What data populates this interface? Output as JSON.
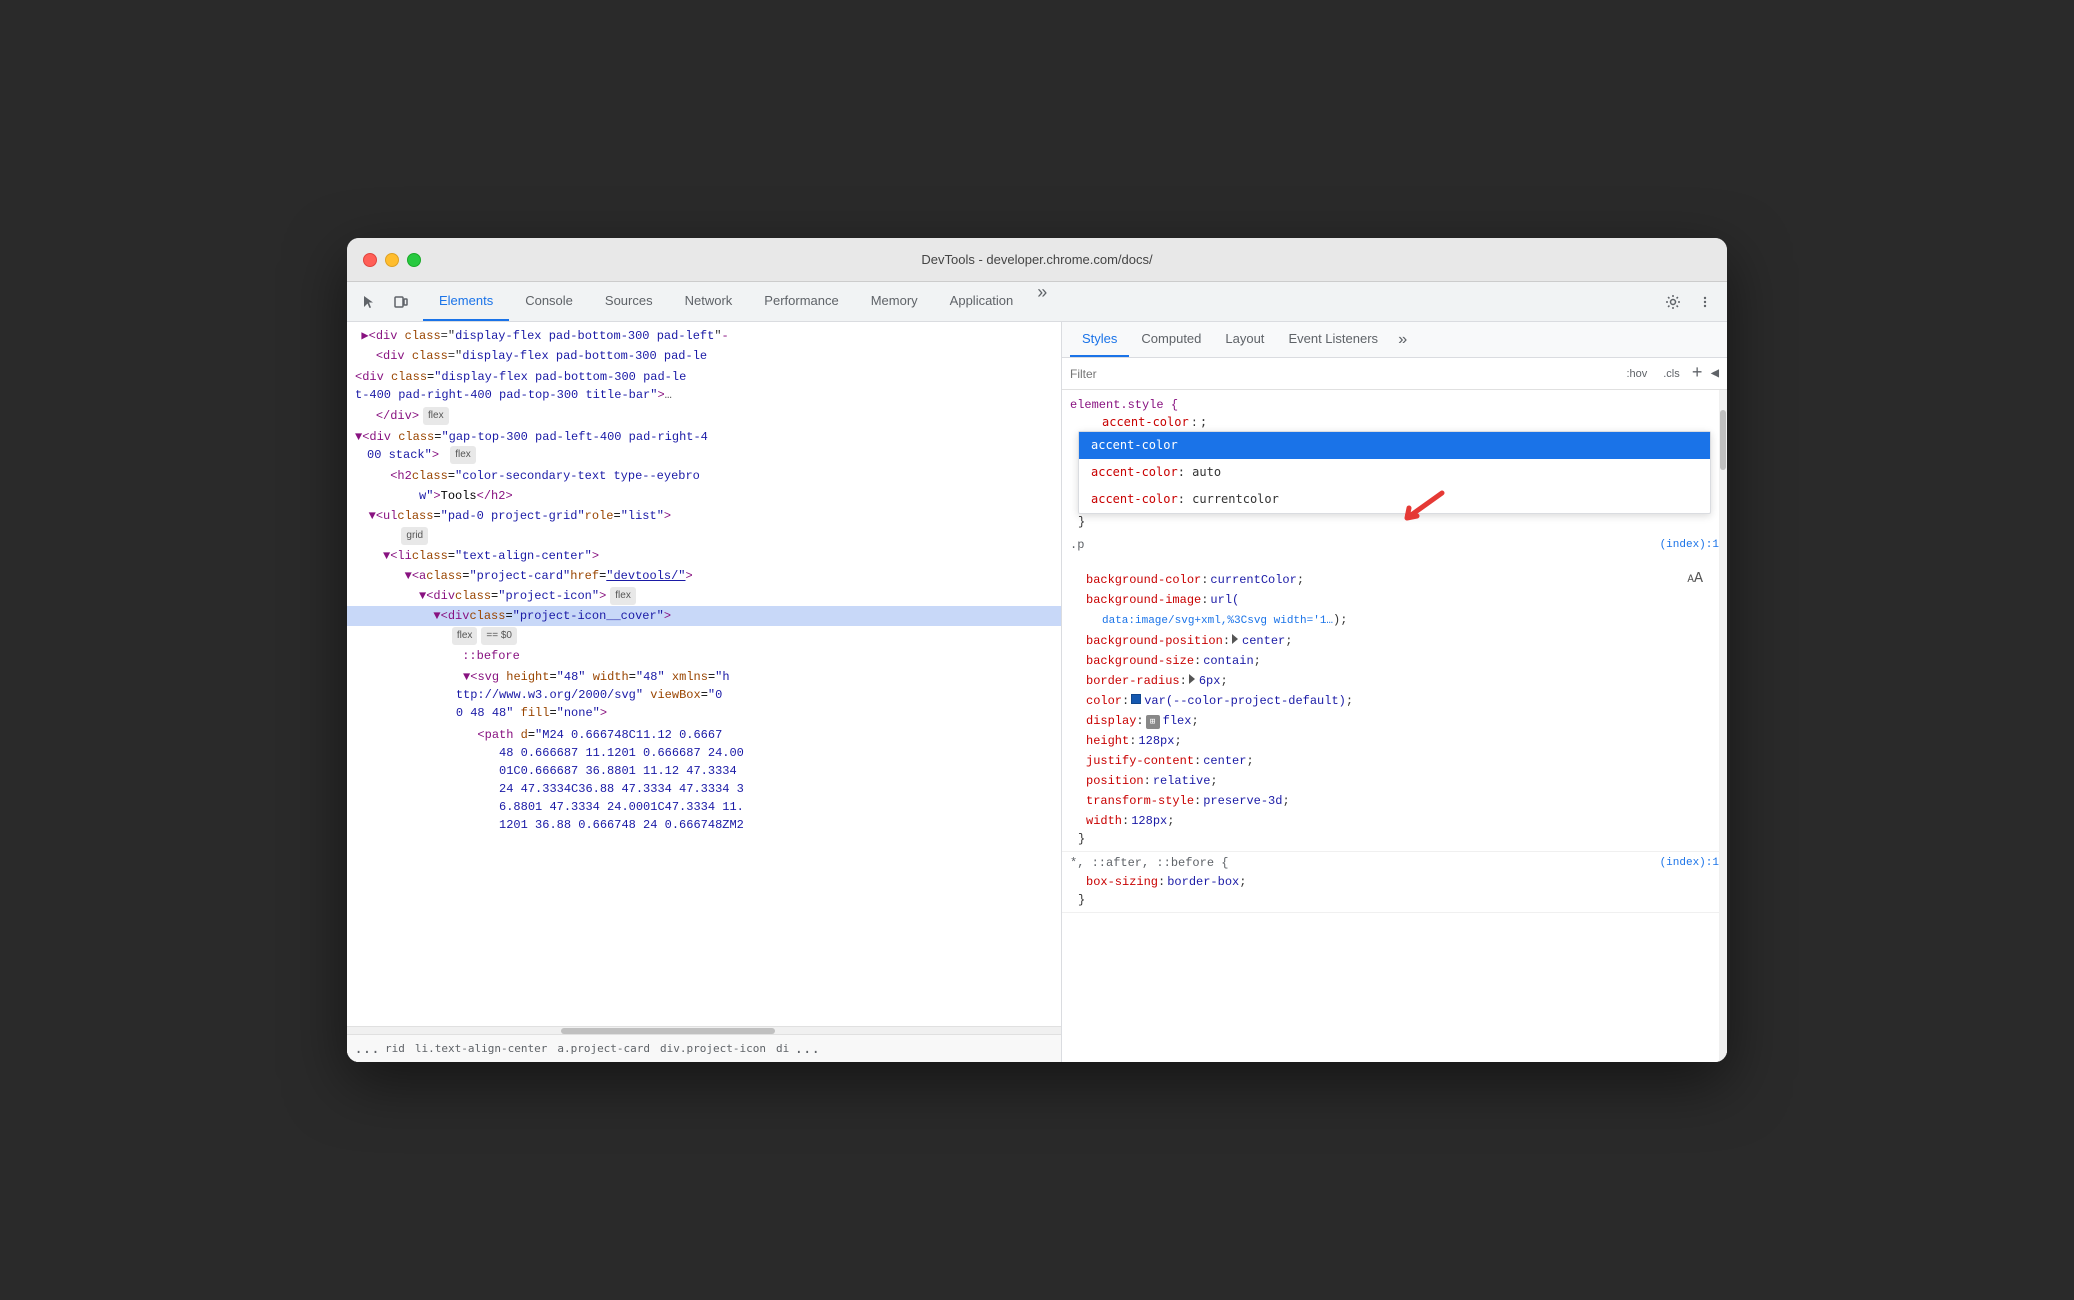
{
  "window": {
    "title": "DevTools - developer.chrome.com/docs/"
  },
  "tabs": {
    "items": [
      {
        "id": "elements",
        "label": "Elements",
        "active": true
      },
      {
        "id": "console",
        "label": "Console",
        "active": false
      },
      {
        "id": "sources",
        "label": "Sources",
        "active": false
      },
      {
        "id": "network",
        "label": "Network",
        "active": false
      },
      {
        "id": "performance",
        "label": "Performance",
        "active": false
      },
      {
        "id": "memory",
        "label": "Memory",
        "active": false
      },
      {
        "id": "application",
        "label": "Application",
        "active": false
      }
    ]
  },
  "secondary_tabs": {
    "items": [
      {
        "id": "styles",
        "label": "Styles",
        "active": true
      },
      {
        "id": "computed",
        "label": "Computed",
        "active": false
      },
      {
        "id": "layout",
        "label": "Layout",
        "active": false
      },
      {
        "id": "event-listeners",
        "label": "Event Listeners",
        "active": false
      }
    ]
  },
  "filter": {
    "placeholder": "Filter",
    "hov_btn": ":hov",
    "cls_btn": ".cls"
  },
  "elements_panel": {
    "code_lines": [
      {
        "text": "<div class=\"display-flex pad-bottom-300 pad-left-400 pad-right-400 pad-top-300 title-bar\">…",
        "indent": 0,
        "has_badge": false
      },
      {
        "text": "</div>",
        "indent": 4,
        "badge": "flex"
      },
      {
        "text": "<div class=\"gap-top-300 pad-left-400 pad-right-400 stack\">",
        "indent": 0,
        "badge": "flex"
      },
      {
        "text": "<h2 class=\"color-secondary-text type--eyebrow\">Tools</h2>",
        "indent": 6
      },
      {
        "text": "<ul class=\"pad-0 project-grid\" role=\"list\">",
        "indent": 3
      },
      {
        "text": "<grid badge>",
        "indent": 7,
        "only_badge": "grid"
      },
      {
        "text": "<li class=\"text-align-center\">",
        "indent": 5
      },
      {
        "text": "<a class=\"project-card\" href=\"devtools/\">",
        "indent": 8
      },
      {
        "text": "<div class=\"project-icon\">",
        "indent": 10,
        "badge": "flex"
      },
      {
        "text": "<div class=\"project-icon__cover\">",
        "indent": 12,
        "badges": [
          "flex",
          "== $0"
        ]
      },
      {
        "text": "::before",
        "indent": 16,
        "pseudo": true
      },
      {
        "text": "<svg height=\"48\" width=\"48\" xmlns=\"http://www.w3.org/2000/svg\" viewBox=\"0 0 48 48\" fill=\"none\">",
        "indent": 14
      },
      {
        "text": "<path d=\"M24 0.666748C11.12 0.666748 0.666687 11.1201 0.666687 24.0001C0.666687 36.8801 11.12 47.3334 24 47.3334C36.88 47.3334 47.3334 36.8801 47.3334 24.0001C47.3334 11.1201 36.88 0.666748 24 0.666748ZM2...",
        "indent": 20
      }
    ]
  },
  "styles_panel": {
    "element_style": {
      "selector": "element.style {",
      "editing_prop": "accent-color",
      "editing_value": ";",
      "close_brace": "}"
    },
    "autocomplete": {
      "items": [
        {
          "text": "accent-color",
          "selected": true
        },
        {
          "text": "accent-color: auto",
          "selected": false
        },
        {
          "text": "accent-color: currentcolor",
          "selected": false
        }
      ]
    },
    "rule_p": {
      "selector": ".p",
      "source": "(index):1",
      "props": [
        {
          "name": "background-color",
          "value": "currentColor;"
        },
        {
          "name": "background-image",
          "value": "url(",
          "continuation": "data:image/svg+xml,%3Csvg width='1…"
        },
        {
          "continuation_close": ");"
        },
        {
          "name": "background-position",
          "value": "▶ center;"
        },
        {
          "name": "background-size",
          "value": "contain;"
        },
        {
          "name": "border-radius",
          "value": "▶ 6px;"
        },
        {
          "name": "color",
          "value": "var(--color-project-default);",
          "has_swatch": true,
          "swatch_color": "#1558b0"
        },
        {
          "name": "display",
          "value": "flex;",
          "has_icon": true
        },
        {
          "name": "height",
          "value": "128px;"
        },
        {
          "name": "justify-content",
          "value": "center;"
        },
        {
          "name": "position",
          "value": "relative;"
        },
        {
          "name": "transform-style",
          "value": "preserve-3d;"
        },
        {
          "name": "width",
          "value": "128px;"
        }
      ]
    },
    "rule_after": {
      "selector": "*, ::after, ::before {",
      "source": "(index):1",
      "props": [
        {
          "name": "box-sizing",
          "value": "border-box;"
        }
      ]
    }
  },
  "breadcrumb": {
    "items": [
      {
        "text": "...",
        "dots": true
      },
      {
        "text": "rid"
      },
      {
        "text": "li.text-align-center"
      },
      {
        "text": "a.project-card"
      },
      {
        "text": "div.project-icon"
      },
      {
        "text": "di",
        "active": false
      },
      {
        "text": "...",
        "more": true
      }
    ]
  }
}
